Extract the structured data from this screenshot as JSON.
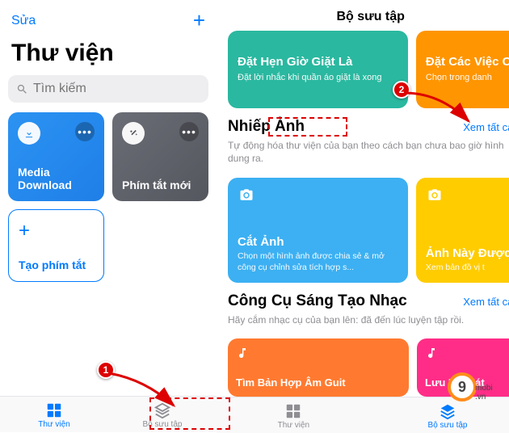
{
  "left": {
    "edit": "Sửa",
    "title": "Thư viện",
    "search_placeholder": "Tìm kiếm",
    "card_blue": "Media Download",
    "card_gray": "Phím tắt mới",
    "create": "Tạo phím tắt",
    "tab_lib": "Thư viện",
    "tab_col": "Bộ sưu tập"
  },
  "right": {
    "header": "Bộ sưu tập",
    "teal_title": "Đặt Hẹn Giờ Giặt Là",
    "teal_sub": "Đặt lời nhắc khi quần áo giặt là xong",
    "orange_title": "Đặt Các Việc Cuối Tuần",
    "orange_sub": "Chọn trong danh",
    "sec1_title": "Nhiếp Ảnh",
    "sec1_link": "Xem tất cả",
    "sec1_desc": "Tự động hóa thư viện của bạn theo cách bạn chưa bao giờ hình dung ra.",
    "sky_title": "Cắt Ảnh",
    "sky_sub": "Chọn một hình ảnh được chia sẻ & mở công cụ chỉnh sửa tích hợp s...",
    "yellow_title": "Ảnh Này Được Ở Đâu?",
    "yellow_sub": "Xem bản đồ vị t",
    "sec2_title": "Công Cụ Sáng Tạo Nhạc",
    "sec2_link": "Xem tất cả",
    "sec2_desc": "Hãy cắm nhạc cụ của bạn lên: đã đến lúc luyện tập rồi.",
    "do_title": "Tìm Bản Hợp Âm Guit",
    "pink_title": "Lưu Bài Hát",
    "tab_lib": "Thư viện",
    "tab_col": "Bộ sưu tập"
  },
  "badges": {
    "b1": "1",
    "b2": "2"
  },
  "logo": {
    "num": "9",
    "suffix": "mobi",
    "domain": ".vn"
  }
}
